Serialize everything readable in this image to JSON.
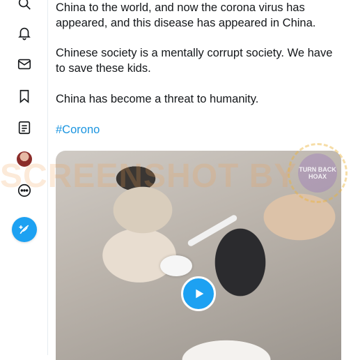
{
  "nav": {
    "items": [
      {
        "name": "search-icon"
      },
      {
        "name": "bell-icon"
      },
      {
        "name": "mail-icon"
      },
      {
        "name": "bookmark-icon"
      },
      {
        "name": "list-icon"
      },
      {
        "name": "avatar"
      },
      {
        "name": "more-icon"
      }
    ],
    "accent": "#1da1f2"
  },
  "tweet": {
    "para1_line1": "China to the world, and now the corona virus has",
    "para1_line2": "appeared, and this disease has appeared in China.",
    "para2_line1": "Chinese society is a mentally corrupt society. We have",
    "para2_line2": "to save these kids.",
    "para3": "China has become a threat to humanity.",
    "hashtag": "#Corono"
  },
  "media": {
    "type": "video",
    "play_icon": "play-icon"
  },
  "watermark": {
    "text": "SCREENSHOT BY",
    "seal_text": "TURN BACK HOAX"
  }
}
